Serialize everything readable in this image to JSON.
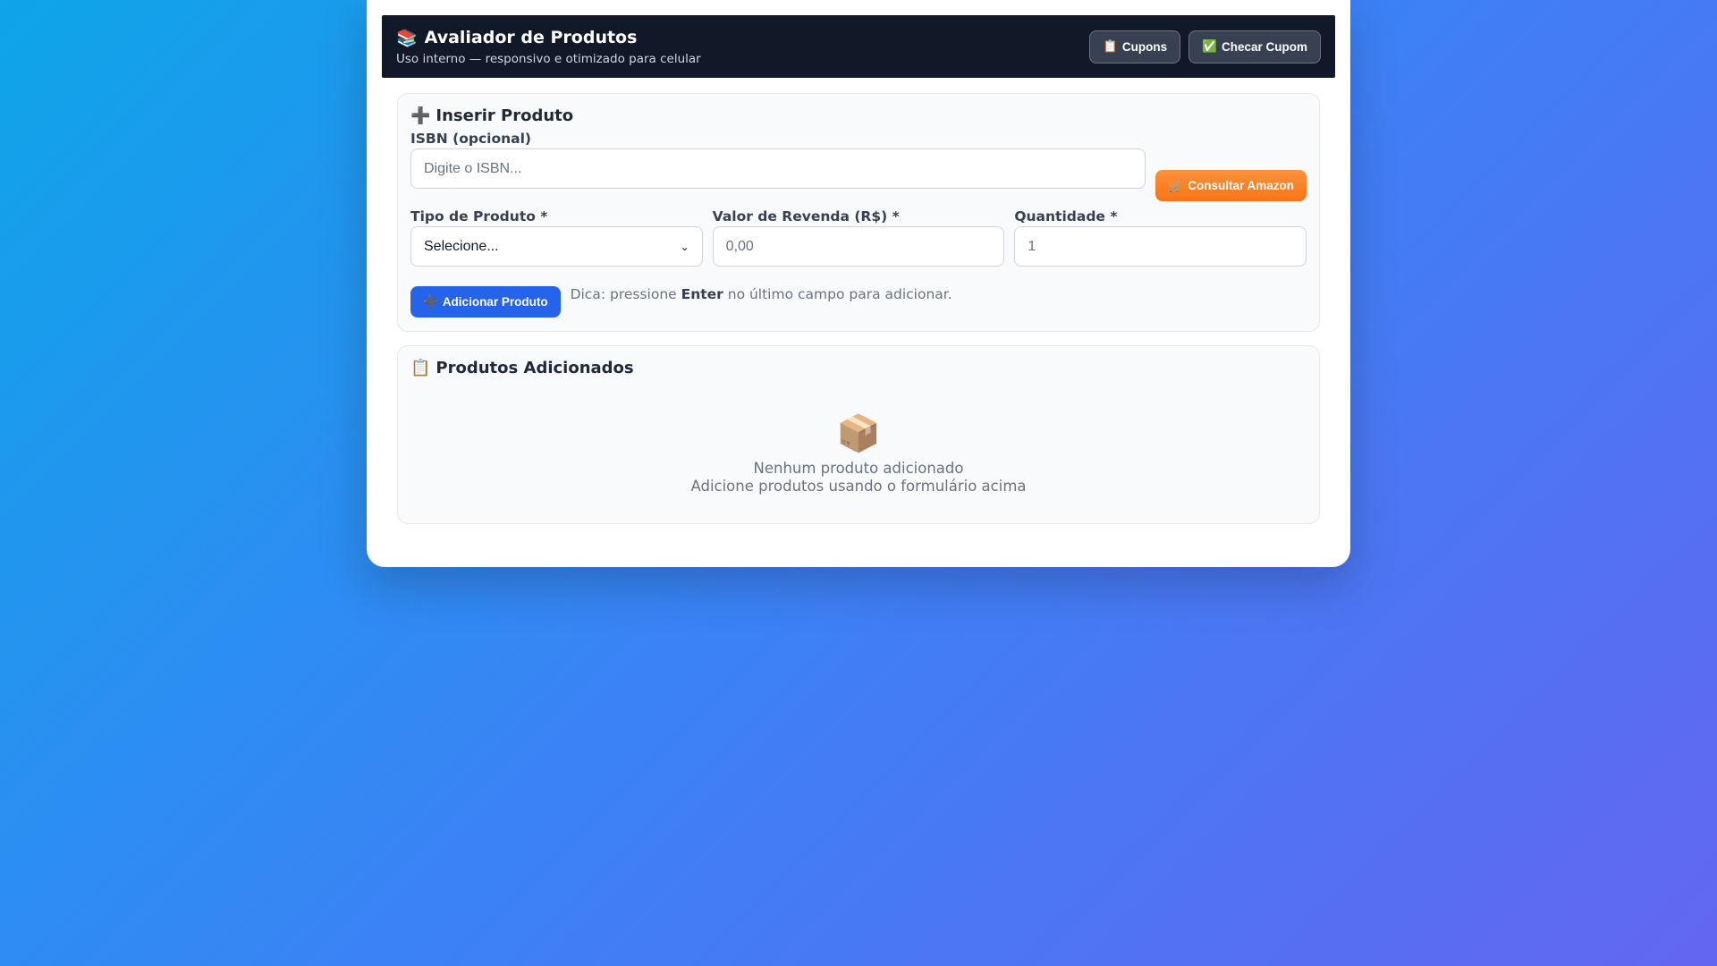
{
  "header": {
    "icon": "📚",
    "title": "Avaliador de Produtos",
    "subtitle": "Uso interno — responsivo e otimizado para celular",
    "buttons": [
      {
        "icon": "📋",
        "label": "Cupons"
      },
      {
        "icon": "✅",
        "label": "Checar Cupom"
      }
    ]
  },
  "insert": {
    "icon": "➕",
    "title": "Inserir Produto",
    "isbn": {
      "label": "ISBN (opcional)",
      "placeholder": "Digite o ISBN...",
      "value": ""
    },
    "amazon_button": {
      "icon": "🛒",
      "label": "Consultar Amazon"
    },
    "product_type": {
      "label": "Tipo de Produto *",
      "selected": "Selecione..."
    },
    "resale_value": {
      "label": "Valor de Revenda (R$) *",
      "placeholder": "0,00",
      "value": ""
    },
    "quantity": {
      "label": "Quantidade *",
      "placeholder": "1",
      "value": ""
    },
    "add_button": {
      "icon": "➕",
      "label": "Adicionar Produto"
    },
    "hint": {
      "prefix": "Dica: pressione ",
      "key": "Enter",
      "suffix": " no último campo para adicionar."
    }
  },
  "list": {
    "icon": "📋",
    "title": "Produtos Adicionados",
    "empty": {
      "icon": "📦",
      "line1": "Nenhum produto adicionado",
      "line2": "Adicione produtos usando o formulário acima"
    }
  },
  "colors": {
    "header_bg": "#111827",
    "primary": "#2563eb",
    "amazon": "#f97316"
  }
}
